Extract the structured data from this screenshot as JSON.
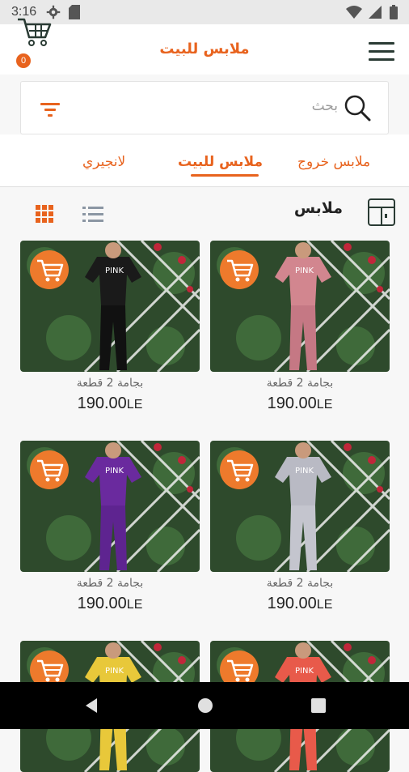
{
  "status_bar": {
    "time": "3:16"
  },
  "header": {
    "title": "ملابس للبيت",
    "cart_count": "0"
  },
  "search": {
    "placeholder": "بحث"
  },
  "tabs": [
    {
      "label": "ملابس خروج",
      "active": false
    },
    {
      "label": "ملابس للبيت",
      "active": true
    },
    {
      "label": "لانجيري",
      "active": false
    }
  ],
  "section": {
    "title": "ملابس"
  },
  "products": [
    {
      "name": "بجامة 2 قطعة",
      "price": "190.00",
      "currency": "LE",
      "shirt_color": "#d2868f",
      "pants_color": "#c57884"
    },
    {
      "name": "بجامة 2 قطعة",
      "price": "190.00",
      "currency": "LE",
      "shirt_color": "#1a1a1a",
      "pants_color": "#111111"
    },
    {
      "name": "بجامة 2 قطعة",
      "price": "190.00",
      "currency": "LE",
      "shirt_color": "#b9bac4",
      "pants_color": "#c4c5ce"
    },
    {
      "name": "بجامة 2 قطعة",
      "price": "190.00",
      "currency": "LE",
      "shirt_color": "#6a2a9e",
      "pants_color": "#5e2490"
    },
    {
      "name": "",
      "price": "",
      "currency": "",
      "shirt_color": "#e85a4a",
      "pants_color": "#e85a4a"
    },
    {
      "name": "",
      "price": "",
      "currency": "",
      "shirt_color": "#e8c83a",
      "pants_color": "#e8c83a"
    }
  ],
  "colors": {
    "accent": "#e8631e",
    "nav_bar": "#000000"
  }
}
